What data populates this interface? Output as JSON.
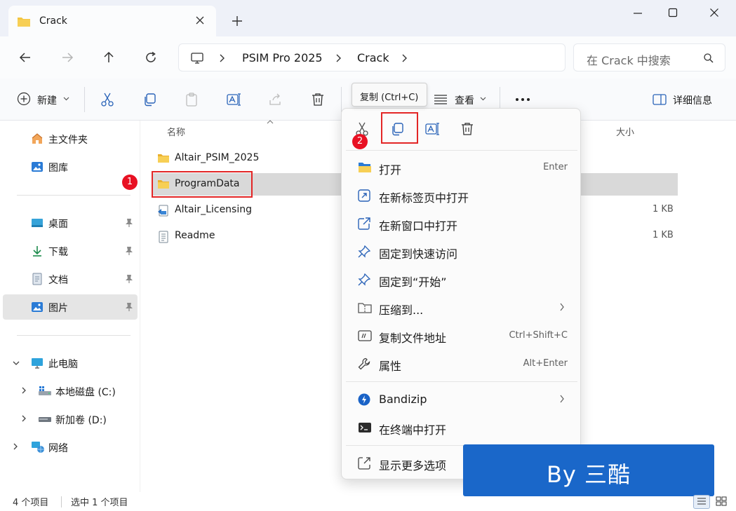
{
  "tab": {
    "title": "Crack",
    "close_icon": "close-icon"
  },
  "address": {
    "crumbs": [
      "PSIM Pro 2025",
      "Crack"
    ],
    "search_placeholder": "在 Crack 中搜索"
  },
  "toolbar": {
    "new_label": "新建",
    "view_label": "查看",
    "details_label": "详细信息"
  },
  "tooltip": {
    "text": "复制 (Ctrl+C)"
  },
  "sidebar": {
    "home": "主文件夹",
    "gallery": "图库",
    "desktop": "桌面",
    "downloads": "下载",
    "documents": "文档",
    "pictures": "图片",
    "thispc": "此电脑",
    "drive_c": "本地磁盘 (C:)",
    "drive_d": "新加卷 (D:)",
    "network": "网络"
  },
  "columns": {
    "name": "名称",
    "size": "大小"
  },
  "files": [
    {
      "name": "Altair_PSIM_2025",
      "size": ""
    },
    {
      "name": "ProgramData",
      "size": ""
    },
    {
      "name": "Altair_Licensing",
      "size": "1 KB"
    },
    {
      "name": "Readme",
      "size": "1 KB"
    }
  ],
  "markers": [
    "1",
    "2"
  ],
  "context_menu": {
    "open": {
      "label": "打开",
      "shortcut": "Enter"
    },
    "open_new_tab": {
      "label": "在新标签页中打开"
    },
    "open_new_window": {
      "label": "在新窗口中打开"
    },
    "pin_quick": {
      "label": "固定到快速访问"
    },
    "pin_start": {
      "label": "固定到“开始”"
    },
    "compress": {
      "label": "压缩到..."
    },
    "copy_path": {
      "label": "复制文件地址",
      "shortcut": "Ctrl+Shift+C"
    },
    "properties": {
      "label": "属性",
      "shortcut": "Alt+Enter"
    },
    "bandizip": {
      "label": "Bandizip"
    },
    "terminal": {
      "label": "在终端中打开"
    },
    "more": {
      "label": "显示更多选项"
    }
  },
  "status": {
    "count": "4 个项目",
    "selected": "选中 1 个项目"
  },
  "watermark": {
    "text": "By 三酷"
  },
  "colors": {
    "accent": "#0067c0",
    "folder": "#f4c542",
    "marker": "#e81123",
    "highlight": "#e32626",
    "watermark_bg": "#1a67c9"
  }
}
